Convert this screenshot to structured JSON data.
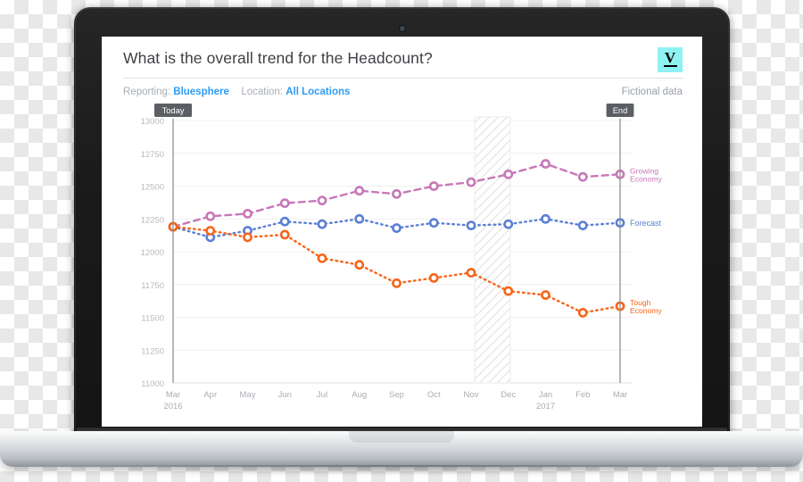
{
  "header": {
    "title": "What is the overall trend for the Headcount?",
    "reporting_label": "Reporting:",
    "reporting_value": "Bluesphere",
    "location_label": "Location:",
    "location_value": "All Locations",
    "note": "Fictional data",
    "logo_letter": "V"
  },
  "colors": {
    "accent_link": "#2f9bf4",
    "growing": "#c778b8",
    "forecast": "#5b7fd4",
    "tough": "#f6651a",
    "marker_label_dark": "#5b5f63",
    "grid": "#f0f0f0",
    "axis_text": "#b6bbc0",
    "logo_bg": "#8ef2f2"
  },
  "markers": [
    {
      "name": "today",
      "label": "Today",
      "x_index": 0
    },
    {
      "name": "end",
      "label": "End",
      "x_index": 12
    }
  ],
  "highlight_band": {
    "from_index": 8,
    "to_index": 9,
    "label": ""
  },
  "chart_data": {
    "type": "line",
    "title": "What is the overall trend for the Headcount?",
    "xlabel": "",
    "ylabel": "",
    "ylim": [
      11000,
      13000
    ],
    "ytick_step": 250,
    "yticks": [
      13000,
      12750,
      12500,
      12250,
      12000,
      11750,
      11500,
      11250,
      11000
    ],
    "grid": true,
    "legend": "right-inline",
    "categories": [
      "Mar",
      "Apr",
      "May",
      "Jun",
      "Jul",
      "Aug",
      "Sep",
      "Oct",
      "Nov",
      "Dec",
      "Jan",
      "Feb",
      "Mar"
    ],
    "year_labels": [
      {
        "index": 0,
        "label": "2016"
      },
      {
        "index": 10,
        "label": "2017"
      }
    ],
    "series": [
      {
        "name": "Growing Economy",
        "color": "#c778b8",
        "style": "dashed",
        "values": [
          12190,
          12270,
          12290,
          12370,
          12390,
          12465,
          12440,
          12500,
          12530,
          12590,
          12670,
          12570,
          12590
        ]
      },
      {
        "name": "Forecast",
        "color": "#5b7fd4",
        "style": "dotted",
        "values": [
          12190,
          12110,
          12160,
          12230,
          12210,
          12250,
          12180,
          12220,
          12200,
          12210,
          12250,
          12200,
          12220
        ]
      },
      {
        "name": "Tough Economy",
        "color": "#f6651a",
        "style": "dotted",
        "values": [
          12190,
          12160,
          12110,
          12130,
          11950,
          11900,
          11760,
          11800,
          11840,
          11700,
          11670,
          11535,
          11585
        ]
      }
    ]
  }
}
